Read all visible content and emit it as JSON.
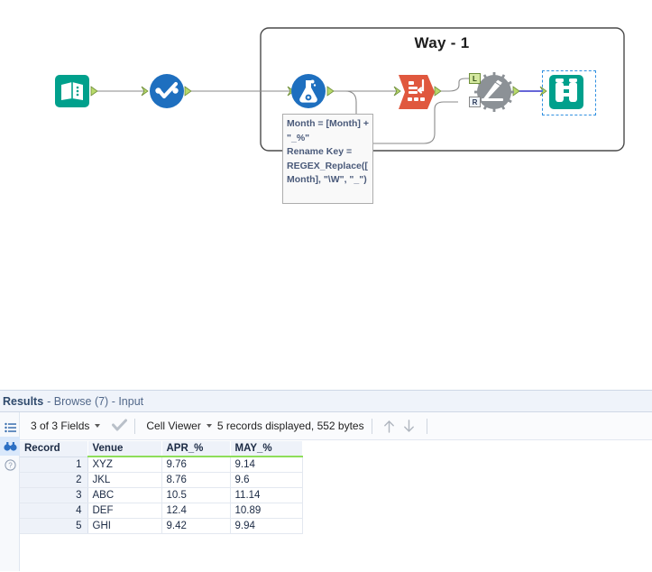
{
  "canvas": {
    "container": {
      "title": "Way - 1"
    },
    "annotation": {
      "text": "Month = [Month] + \"_%\"\nRename Key = REGEX_Replace([Month], \"\\W\", \"_\")"
    },
    "tools": [
      {
        "id": "input-data",
        "name": "Input Data",
        "icon": "book-icon"
      },
      {
        "id": "select",
        "name": "Select",
        "icon": "check-circle-icon"
      },
      {
        "id": "formula",
        "name": "Formula",
        "icon": "flask-icon"
      },
      {
        "id": "transpose",
        "name": "Transpose",
        "icon": "transpose-icon"
      },
      {
        "id": "dynamic-rename",
        "name": "Dynamic Rename",
        "icon": "gear-pencil-icon"
      },
      {
        "id": "browse",
        "name": "Browse",
        "icon": "binoculars-icon"
      }
    ],
    "anchors": {
      "left": "L",
      "right": "R"
    },
    "colors": {
      "input_teal": "#00A08C",
      "select_blue": "#1E6FBF",
      "formula_blue": "#1E6FBF",
      "transpose_red": "#E0583E",
      "rename_gray": "#8C9196",
      "browse_teal": "#00A08C",
      "selection_blue": "#2F8FE0",
      "connector_green": "#B8D96A"
    }
  },
  "results": {
    "header": {
      "title": "Results",
      "subtitle": "- Browse (7) - Input"
    },
    "rail": [
      {
        "id": "messages",
        "icon": "list-icon",
        "active": false
      },
      {
        "id": "browse",
        "icon": "binoculars-icon",
        "active": true
      },
      {
        "id": "help",
        "icon": "help-icon",
        "active": false
      }
    ],
    "toolbar": {
      "fields_label": "3 of 3 Fields",
      "check_icon": "checkmark-icon",
      "view_label": "Cell Viewer",
      "status": "5 records displayed, 552 bytes",
      "up_icon": "arrow-up-icon",
      "down_icon": "arrow-down-icon"
    },
    "grid": {
      "columns": [
        "Record",
        "Venue",
        "APR_%",
        "MAY_%"
      ],
      "rows": [
        {
          "record": "1",
          "venue": "XYZ",
          "apr": "9.76",
          "may": "9.14"
        },
        {
          "record": "2",
          "venue": "JKL",
          "apr": "8.76",
          "may": "9.6"
        },
        {
          "record": "3",
          "venue": "ABC",
          "apr": "10.5",
          "may": "11.14"
        },
        {
          "record": "4",
          "venue": "DEF",
          "apr": "12.4",
          "may": "10.89"
        },
        {
          "record": "5",
          "venue": "GHI",
          "apr": "9.42",
          "may": "9.94"
        }
      ]
    }
  }
}
